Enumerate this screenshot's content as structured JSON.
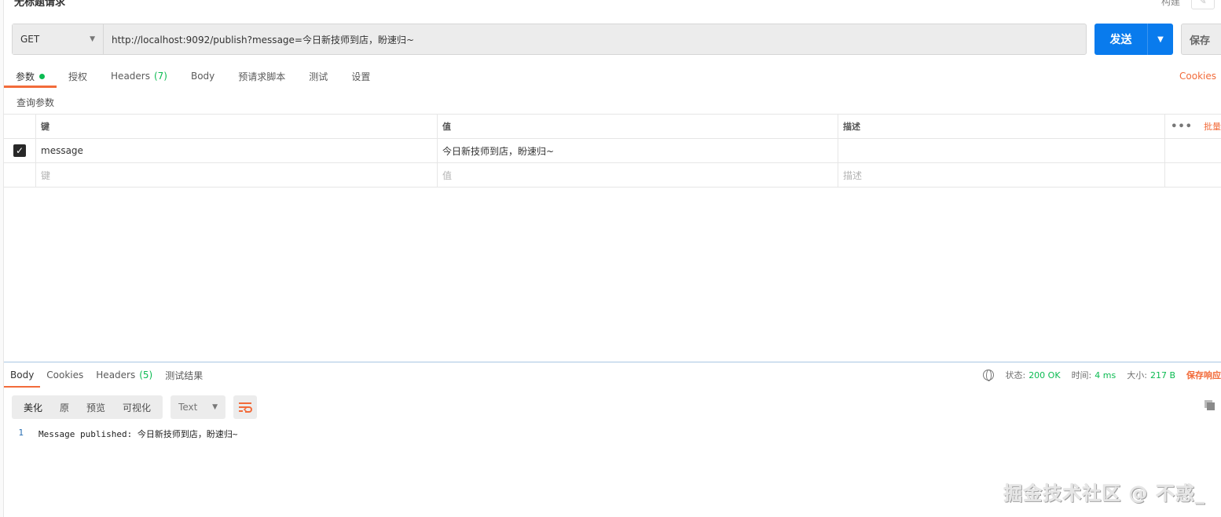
{
  "request": {
    "title": "无标题请求",
    "top_right_label": "构建",
    "method": "GET",
    "url": "http://localhost:9092/publish?message=今日新技师到店，盼速归~",
    "send_label": "发送",
    "save_label": "保存"
  },
  "request_tabs": [
    {
      "label": "参数"
    },
    {
      "label": "授权"
    },
    {
      "label": "Headers",
      "count": "(7)"
    },
    {
      "label": "Body"
    },
    {
      "label": "预请求脚本"
    },
    {
      "label": "测试"
    },
    {
      "label": "设置"
    }
  ],
  "cookies_link": "Cookies",
  "query_params": {
    "section_label": "查询参数",
    "headers": {
      "key": "键",
      "value": "值",
      "description": "描述",
      "bulk_edit": "批量"
    },
    "rows": [
      {
        "checked": true,
        "key": "message",
        "value": "今日新技师到店，盼速归~",
        "description": ""
      }
    ],
    "placeholder": {
      "key": "键",
      "value": "值",
      "description": "描述"
    }
  },
  "response_tabs": [
    {
      "label": "Body"
    },
    {
      "label": "Cookies"
    },
    {
      "label": "Headers",
      "count": "(5)"
    },
    {
      "label": "测试结果"
    }
  ],
  "response_meta": {
    "status_label": "状态:",
    "status_value": "200 OK",
    "time_label": "时间:",
    "time_value": "4 ms",
    "size_label": "大小:",
    "size_value": "217 B",
    "save_response": "保存响应"
  },
  "view_modes": [
    "美化",
    "原",
    "预览",
    "可视化"
  ],
  "format_select": "Text",
  "response_body": {
    "lines": [
      {
        "n": "1",
        "text": "Message published: 今日新技师到店，盼速归~"
      }
    ]
  },
  "watermark": "掘金技术社区 @ 不惑_",
  "colors": {
    "accent": "#f26b3a",
    "send": "#097bed",
    "success": "#0cbb52"
  }
}
